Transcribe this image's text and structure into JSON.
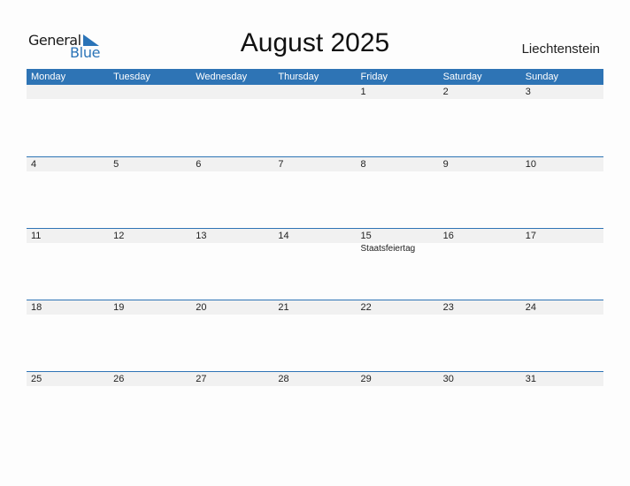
{
  "logo": {
    "part1": "General",
    "part2": "Blue",
    "icon": "triangle-flag-icon"
  },
  "title": "August 2025",
  "country": "Liechtenstein",
  "colors": {
    "accent": "#2e74b5",
    "date_bar": "#f1f1f1"
  },
  "weekdays": [
    "Monday",
    "Tuesday",
    "Wednesday",
    "Thursday",
    "Friday",
    "Saturday",
    "Sunday"
  ],
  "weeks": [
    [
      {
        "day": ""
      },
      {
        "day": ""
      },
      {
        "day": ""
      },
      {
        "day": ""
      },
      {
        "day": "1"
      },
      {
        "day": "2"
      },
      {
        "day": "3"
      }
    ],
    [
      {
        "day": "4"
      },
      {
        "day": "5"
      },
      {
        "day": "6"
      },
      {
        "day": "7"
      },
      {
        "day": "8"
      },
      {
        "day": "9"
      },
      {
        "day": "10"
      }
    ],
    [
      {
        "day": "11"
      },
      {
        "day": "12"
      },
      {
        "day": "13"
      },
      {
        "day": "14"
      },
      {
        "day": "15",
        "holiday": "Staatsfeiertag"
      },
      {
        "day": "16"
      },
      {
        "day": "17"
      }
    ],
    [
      {
        "day": "18"
      },
      {
        "day": "19"
      },
      {
        "day": "20"
      },
      {
        "day": "21"
      },
      {
        "day": "22"
      },
      {
        "day": "23"
      },
      {
        "day": "24"
      }
    ],
    [
      {
        "day": "25"
      },
      {
        "day": "26"
      },
      {
        "day": "27"
      },
      {
        "day": "28"
      },
      {
        "day": "29"
      },
      {
        "day": "30"
      },
      {
        "day": "31"
      }
    ]
  ]
}
